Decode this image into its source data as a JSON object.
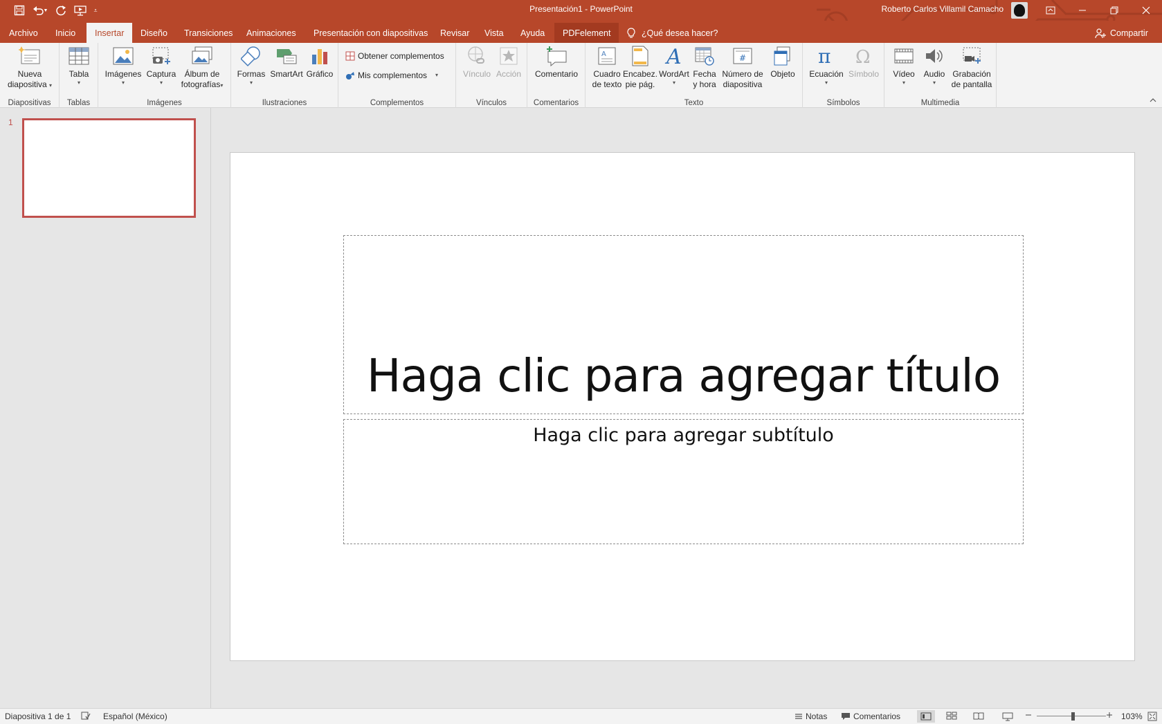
{
  "window": {
    "title": "Presentación1  -  PowerPoint",
    "user_name": "Roberto Carlos Villamil Camacho"
  },
  "tabs": [
    "Archivo",
    "Inicio",
    "Insertar",
    "Diseño",
    "Transiciones",
    "Animaciones",
    "Presentación con diapositivas",
    "Revisar",
    "Vista",
    "Ayuda",
    "PDFelement"
  ],
  "active_tab": "Insertar",
  "tell_me": "¿Qué desea hacer?",
  "share": "Compartir",
  "ribbon": {
    "diapositivas": {
      "label": "Diapositivas",
      "nueva_1": "Nueva",
      "nueva_2": "diapositiva"
    },
    "tablas": {
      "label": "Tablas",
      "tabla": "Tabla"
    },
    "imagenes": {
      "label": "Imágenes",
      "imagenes": "Imágenes",
      "captura": "Captura",
      "album_1": "Álbum de",
      "album_2": "fotografías"
    },
    "ilustraciones": {
      "label": "Ilustraciones",
      "formas": "Formas",
      "smartart": "SmartArt",
      "grafico": "Gráfico"
    },
    "complementos": {
      "label": "Complementos",
      "obtener": "Obtener complementos",
      "mis": "Mis complementos"
    },
    "vinculos": {
      "label": "Vínculos",
      "vinculo": "Vínculo",
      "accion": "Acción"
    },
    "comentarios": {
      "label": "Comentarios",
      "comentario": "Comentario"
    },
    "texto": {
      "label": "Texto",
      "cuadro_1": "Cuadro",
      "cuadro_2": "de texto",
      "encab_1": "Encabez.",
      "encab_2": "pie pág.",
      "wordart": "WordArt",
      "fecha_1": "Fecha",
      "fecha_2": "y hora",
      "numero_1": "Número de",
      "numero_2": "diapositiva",
      "objeto": "Objeto"
    },
    "simbolos": {
      "label": "Símbolos",
      "ecuacion": "Ecuación",
      "simbolo": "Símbolo"
    },
    "multimedia": {
      "label": "Multimedia",
      "video": "Vídeo",
      "audio": "Audio",
      "grab_1": "Grabación",
      "grab_2": "de pantalla"
    }
  },
  "thumbnail": {
    "number": "1"
  },
  "slide": {
    "title_placeholder": "Haga clic para agregar título",
    "subtitle_placeholder": "Haga clic para agregar subtítulo"
  },
  "status": {
    "slide_info": "Diapositiva 1 de 1",
    "language": "Español (México)",
    "notes": "Notas",
    "comments": "Comentarios",
    "zoom": "103%",
    "zoom_level": 0.52
  },
  "colors": {
    "accent": "#b7472a",
    "thumb_border": "#c0504d"
  }
}
